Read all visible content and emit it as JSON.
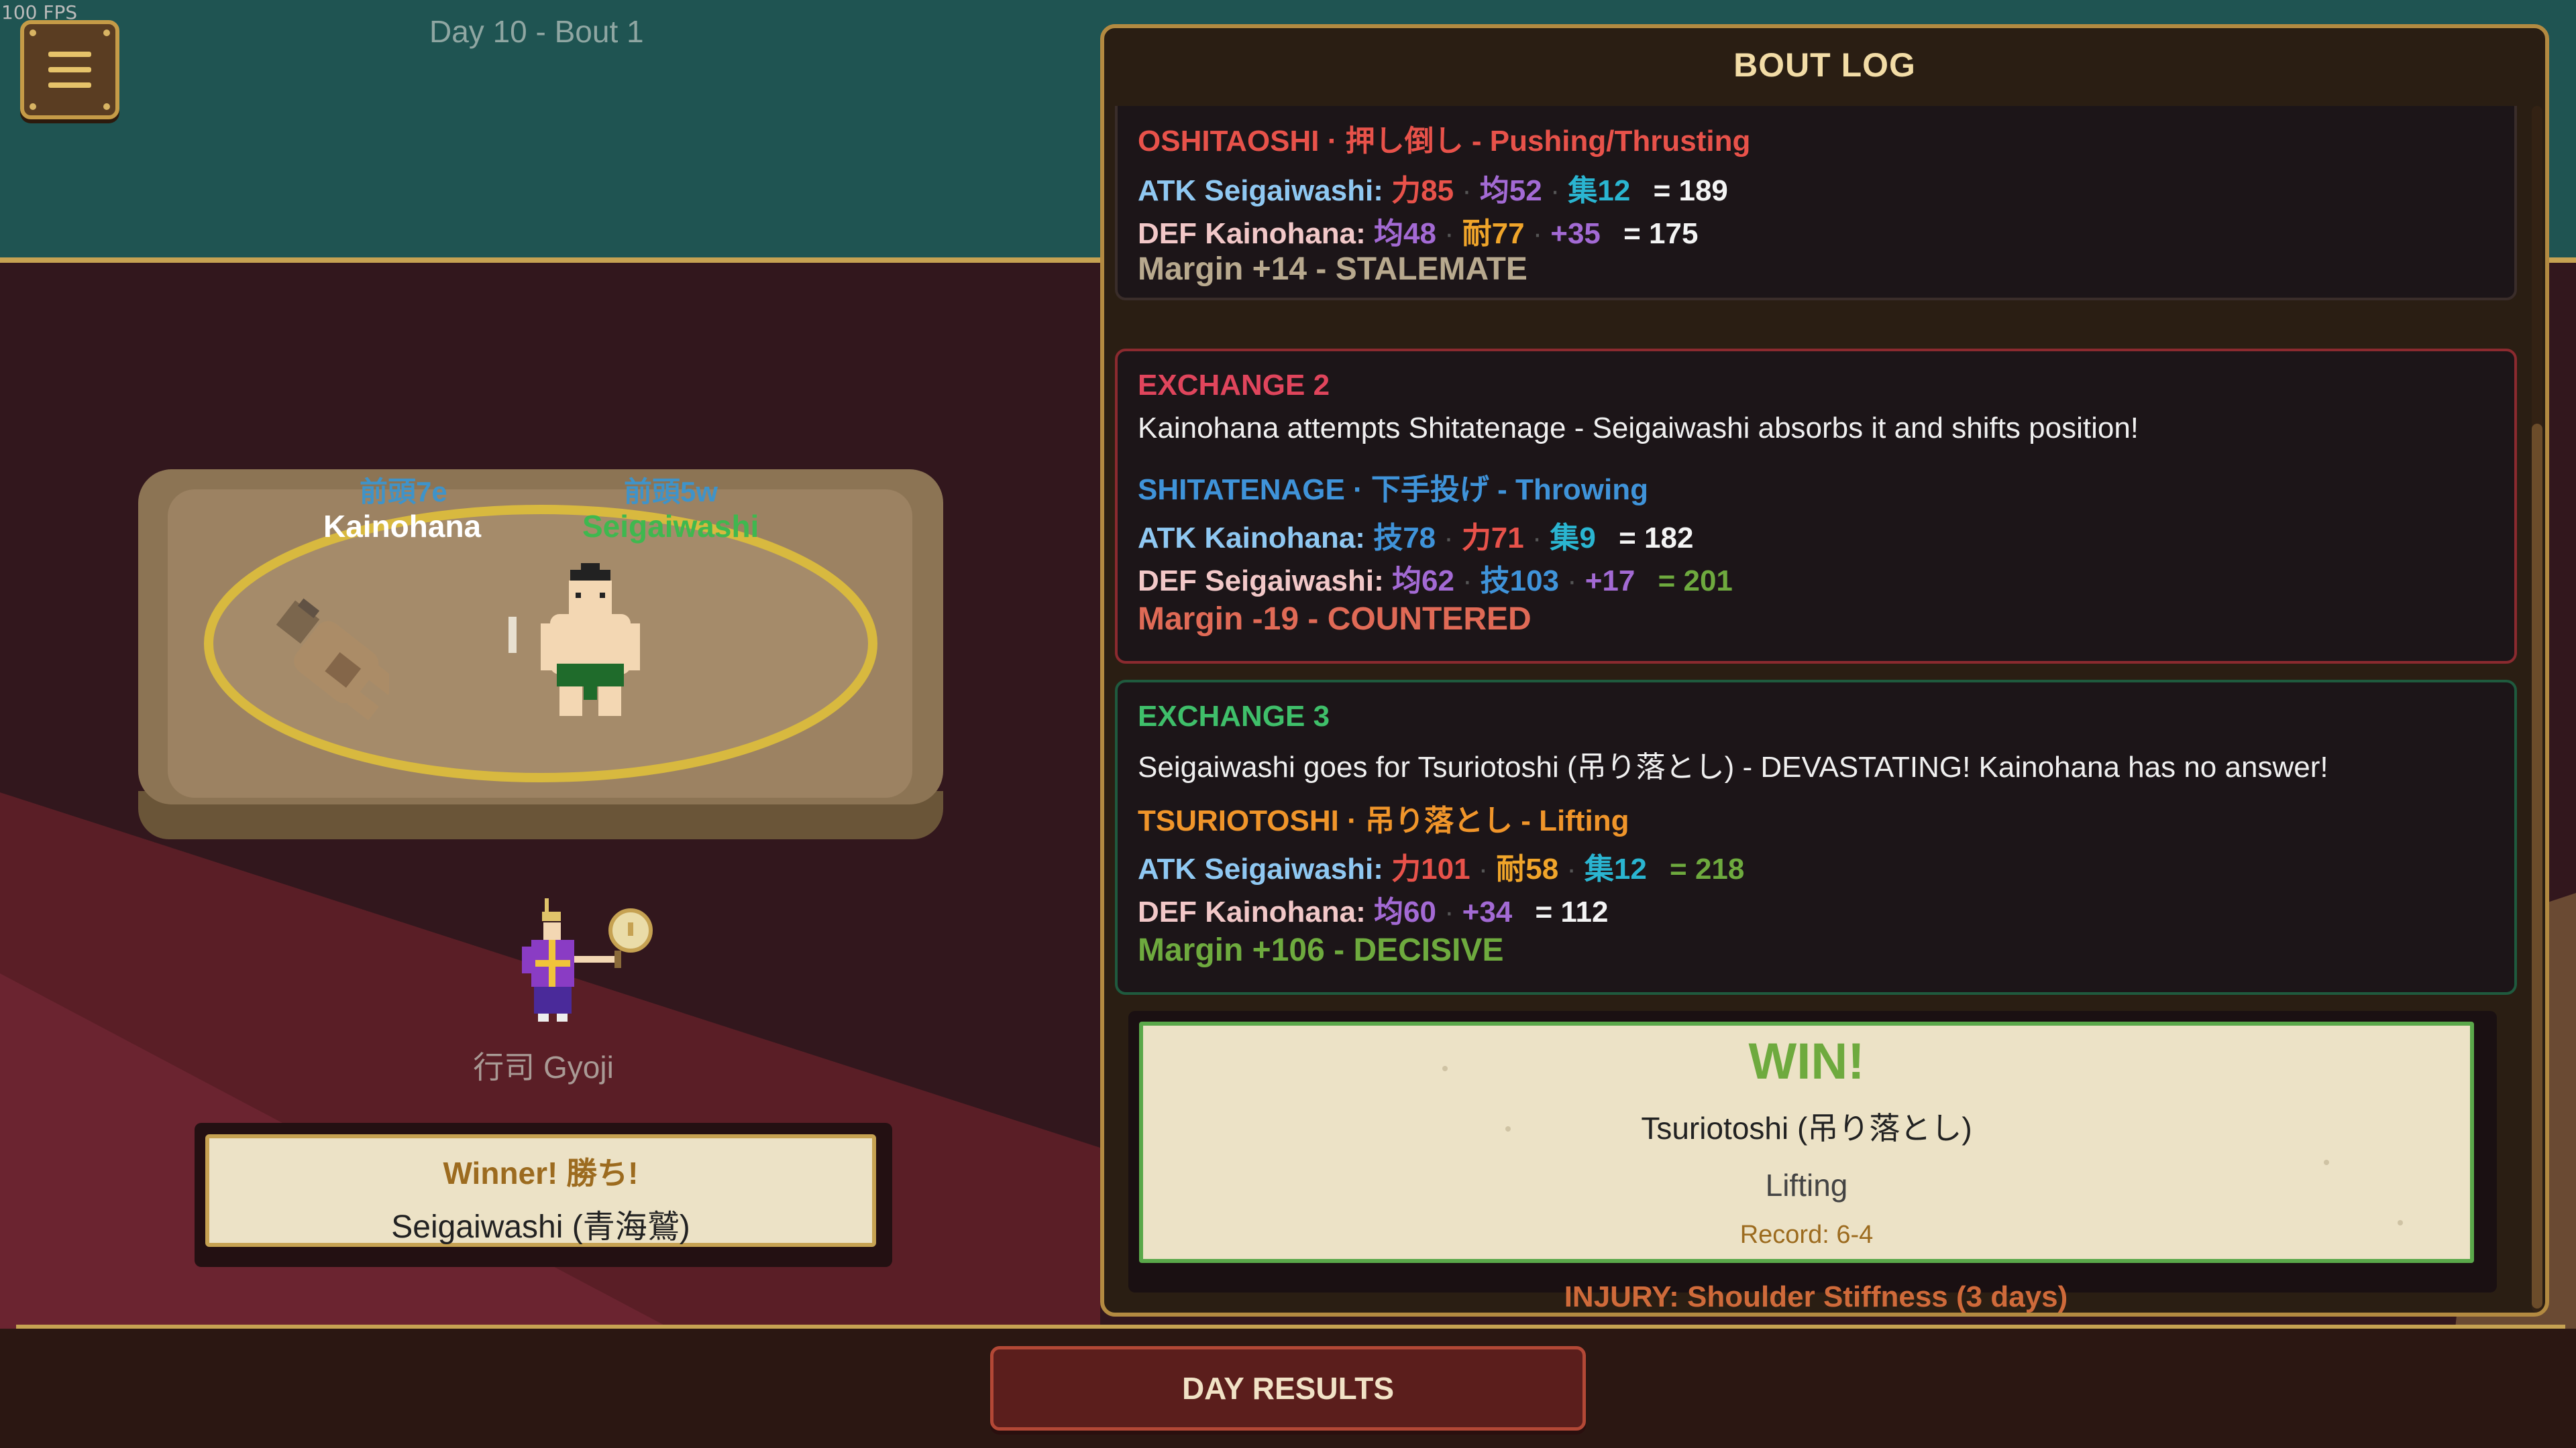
{
  "hud": {
    "fps": "100 FPS",
    "day_label": "Day 10 - Bout 1"
  },
  "ring": {
    "east": {
      "rank": "前頭7e",
      "name": "Kainohana",
      "name_color": "#ffffff"
    },
    "west": {
      "rank": "前頭5w",
      "name": "Seigaiwashi",
      "name_color": "#3fb84f"
    }
  },
  "gyoji": {
    "label": "行司  Gyoji"
  },
  "winner": {
    "title": "Winner!  勝ち!",
    "name": "Seigaiwashi  (青海鷲)"
  },
  "log": {
    "title": "BOUT LOG",
    "exchanges": [
      {
        "title": "",
        "description": "",
        "technique": "OSHITAOSHI · 押し倒し - Pushing/Thrusting",
        "technique_color": "#e8524a",
        "atk": {
          "label": "ATK Seigaiwashi:",
          "stats": [
            {
              "text": "力85",
              "color": "#e8524a"
            },
            {
              "text": "均52",
              "color": "#a36ad4"
            },
            {
              "text": "集12",
              "color": "#2ab5d1"
            }
          ],
          "total": "= 189"
        },
        "def": {
          "label": "DEF Kainohana:",
          "stats": [
            {
              "text": "均48",
              "color": "#a36ad4"
            },
            {
              "text": "耐77",
              "color": "#f0a52a"
            },
            {
              "text": "+35",
              "color": "#a36ad4"
            }
          ],
          "total": "= 175"
        },
        "margin": "Margin +14 - STALEMATE",
        "margin_color": "#b8a98e",
        "border_color": "#3a2d2a"
      },
      {
        "title": "EXCHANGE 2",
        "title_color": "#e0455c",
        "description": "Kainohana attempts Shitatenage - Seigaiwashi absorbs it and shifts position!",
        "technique": "SHITATENAGE · 下手投げ - Throwing",
        "technique_color": "#3f93d9",
        "atk": {
          "label": "ATK Kainohana:",
          "stats": [
            {
              "text": "技78",
              "color": "#3f93d9"
            },
            {
              "text": "力71",
              "color": "#e8524a"
            },
            {
              "text": "集9",
              "color": "#2ab5d1"
            }
          ],
          "total": "= 182",
          "total_color": "#f4f4f4"
        },
        "def": {
          "label": "DEF Seigaiwashi:",
          "stats": [
            {
              "text": "均62",
              "color": "#a36ad4"
            },
            {
              "text": "技103",
              "color": "#3f93d9"
            },
            {
              "text": "+17",
              "color": "#a36ad4"
            }
          ],
          "total": "= 201",
          "total_color": "#6eaa3e"
        },
        "margin": "Margin -19 - COUNTERED",
        "margin_color": "#e06a56",
        "border_color": "#8b2a2f"
      },
      {
        "title": "EXCHANGE 3",
        "title_color": "#3fbf6a",
        "description": "Seigaiwashi goes for Tsuriotoshi (吊り落とし) - DEVASTATING! Kainohana has no answer!",
        "technique": "TSURIOTOSHI · 吊り落とし - Lifting",
        "technique_color": "#f0952a",
        "atk": {
          "label": "ATK Seigaiwashi:",
          "stats": [
            {
              "text": "力101",
              "color": "#e8524a"
            },
            {
              "text": "耐58",
              "color": "#f0a52a"
            },
            {
              "text": "集12",
              "color": "#2ab5d1"
            }
          ],
          "total": "= 218",
          "total_color": "#6eaa3e"
        },
        "def": {
          "label": "DEF Kainohana:",
          "stats": [
            {
              "text": "均60",
              "color": "#a36ad4"
            },
            {
              "text": "+34",
              "color": "#a36ad4"
            }
          ],
          "total": "= 112",
          "total_color": "#f4f4f4"
        },
        "margin": "Margin +106 - DECISIVE",
        "margin_color": "#6eaa3e",
        "border_color": "#1f5a3e"
      }
    ],
    "result": {
      "headline": "WIN!",
      "technique": "Tsuriotoshi (吊り落とし)",
      "type": "Lifting",
      "record": "Record: 6-4"
    },
    "injury": "INJURY: Shoulder Stiffness (3 days)"
  },
  "buttons": {
    "day_results": "DAY RESULTS"
  },
  "colors": {
    "sky": "#1f5452",
    "gold_trim": "#c6a252",
    "floor": "#32171d"
  }
}
